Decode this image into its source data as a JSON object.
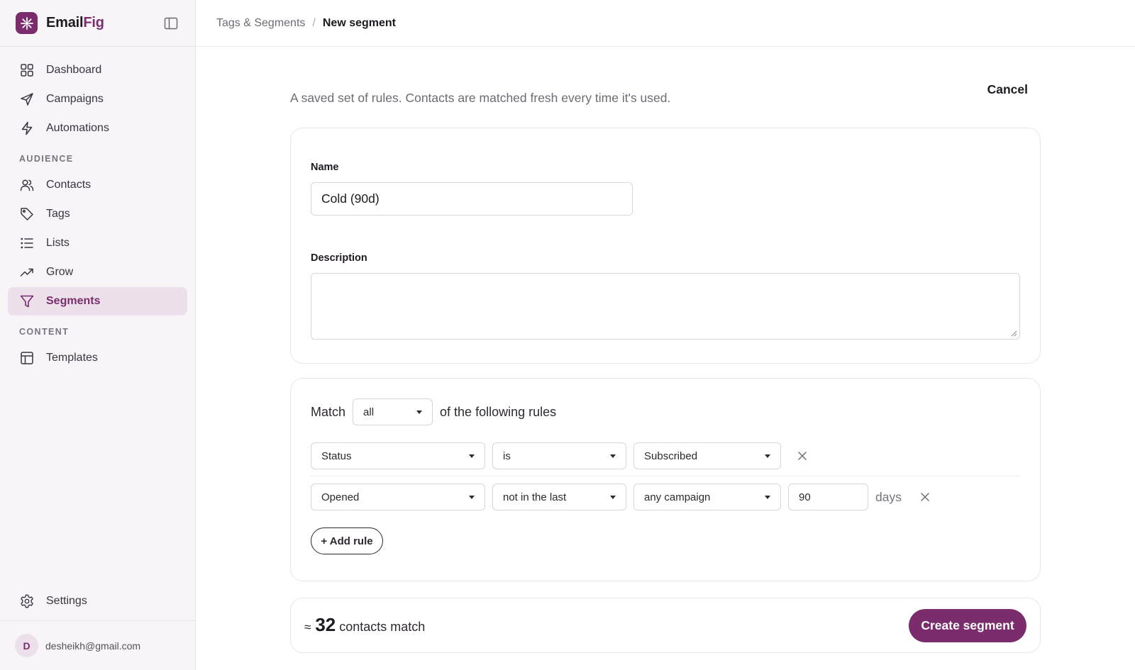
{
  "brand": {
    "name_part1": "Email",
    "name_part2": "Fig",
    "accent": "#7b2c6d"
  },
  "sidebar": {
    "items": [
      {
        "label": "Dashboard",
        "icon": "grid-icon"
      },
      {
        "label": "Campaigns",
        "icon": "send-icon"
      },
      {
        "label": "Automations",
        "icon": "bolt-icon"
      }
    ],
    "audience_heading": "AUDIENCE",
    "audience_items": [
      {
        "label": "Contacts",
        "icon": "users-icon"
      },
      {
        "label": "Tags",
        "icon": "tag-icon"
      },
      {
        "label": "Lists",
        "icon": "list-icon"
      },
      {
        "label": "Grow",
        "icon": "trending-up-icon"
      },
      {
        "label": "Segments",
        "icon": "filter-icon",
        "active": true
      }
    ],
    "content_heading": "CONTENT",
    "content_items": [
      {
        "label": "Templates",
        "icon": "layout-icon"
      }
    ],
    "settings_label": "Settings",
    "user": {
      "initial": "D",
      "email": "desheikh@gmail.com"
    }
  },
  "breadcrumb": {
    "parent": "Tags & Segments",
    "separator": "/",
    "current": "New segment"
  },
  "page": {
    "subtitle": "A saved set of rules. Contacts are matched fresh every time it's used.",
    "cancel_label": "Cancel"
  },
  "form": {
    "name_label": "Name",
    "name_value": "Cold (90d)",
    "description_label": "Description",
    "description_value": ""
  },
  "rules": {
    "match_label": "Match",
    "match_value": "all",
    "match_suffix": "of the following rules",
    "rows": [
      {
        "field": "Status",
        "operator": "is",
        "value": "Subscribed"
      },
      {
        "field": "Opened",
        "operator": "not in the last",
        "value": "any campaign",
        "amount": "90",
        "unit": "days"
      }
    ],
    "add_rule_label": "+ Add rule"
  },
  "summary": {
    "approx": "≈",
    "count": "32",
    "count_text": "contacts match",
    "create_label": "Create segment"
  }
}
